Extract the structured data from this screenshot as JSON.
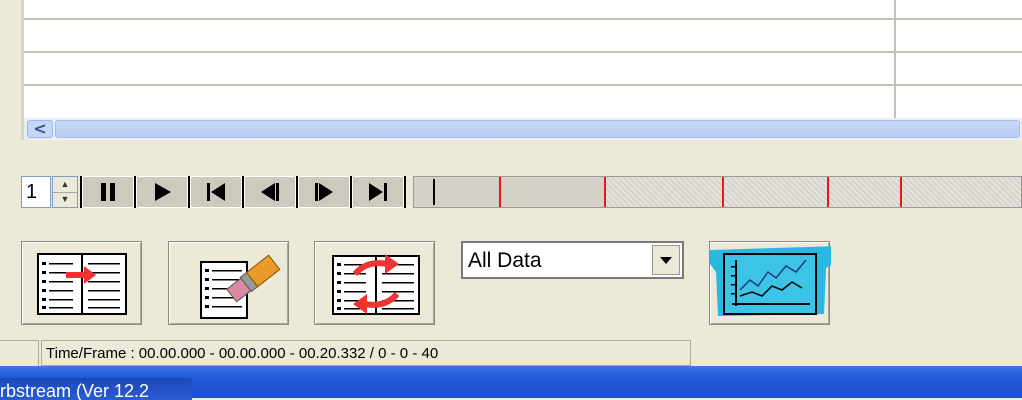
{
  "table": {
    "rows": 4
  },
  "scrollbar": {
    "left_arrow": "<"
  },
  "playback": {
    "frame_spinner_value": "1",
    "buttons": [
      "pause-icon",
      "play-icon",
      "skip-to-start-icon",
      "step-back-icon",
      "step-forward-icon",
      "skip-to-end-icon"
    ]
  },
  "timeline": {
    "marker_color": "#e21a1a"
  },
  "toolbar": {
    "icons": [
      "export-list-icon",
      "erase-list-icon",
      "swap-lists-icon"
    ],
    "data_select": {
      "value": "All Data"
    },
    "graph_icon": "graph-icon",
    "graph_highlight_color": "#29b8e0"
  },
  "status": {
    "time_frame": "Time/Frame : 00.00.000 - 00.00.000 - 00.20.332 / 0 - 0 - 40"
  },
  "taskbar": {
    "task_label": "rbstream (Ver 12.2"
  }
}
